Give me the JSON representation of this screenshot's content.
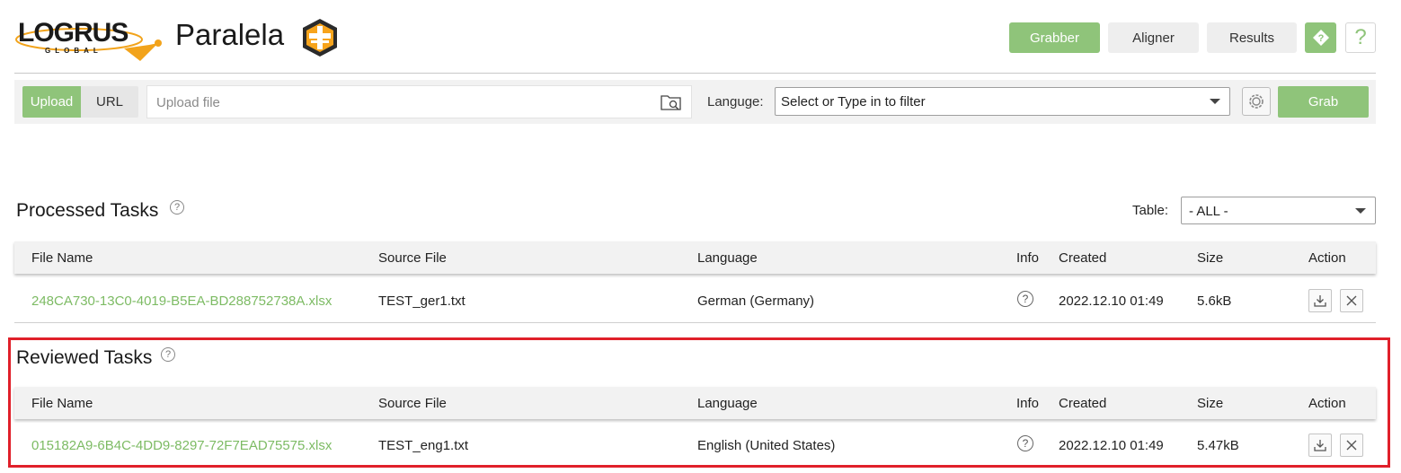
{
  "header": {
    "logo_text": "LOGRUS",
    "logo_subtext": "GLOBAL",
    "app_title": "Paralela",
    "nav": {
      "grabber": "Grabber",
      "aligner": "Aligner",
      "results": "Results",
      "diamond_icon": "question-diamond-icon",
      "help": "?"
    }
  },
  "toolbar": {
    "upload_tab": "Upload",
    "url_tab": "URL",
    "upload_placeholder": "Upload file",
    "language_label": "Languge:",
    "language_placeholder": "Select or Type in to filter",
    "grab_label": "Grab"
  },
  "processed": {
    "title": "Processed Tasks",
    "help": "?",
    "table_label": "Table:",
    "table_filter": "- ALL -",
    "columns": [
      "File Name",
      "Source File",
      "Language",
      "Info",
      "Created",
      "Size",
      "Action"
    ],
    "rows": [
      {
        "file_name": "248CA730-13C0-4019-B5EA-BD288752738A.xlsx",
        "source_file": "TEST_ger1.txt",
        "language": "German (Germany)",
        "info": "?",
        "created": "2022.12.10 01:49",
        "size": "5.6kB"
      }
    ]
  },
  "reviewed": {
    "title": "Reviewed Tasks",
    "help": "?",
    "columns": [
      "File Name",
      "Source File",
      "Language",
      "Info",
      "Created",
      "Size",
      "Action"
    ],
    "rows": [
      {
        "file_name": "015182A9-6B4C-4DD9-8297-72F7EAD75575.xlsx",
        "source_file": "TEST_eng1.txt",
        "language": "English (United States)",
        "info": "?",
        "created": "2022.12.10 01:49",
        "size": "5.47kB"
      }
    ]
  },
  "colors": {
    "accent_green": "#8fc47a",
    "link_green": "#7dbb64",
    "highlight_red": "#e0202a"
  }
}
